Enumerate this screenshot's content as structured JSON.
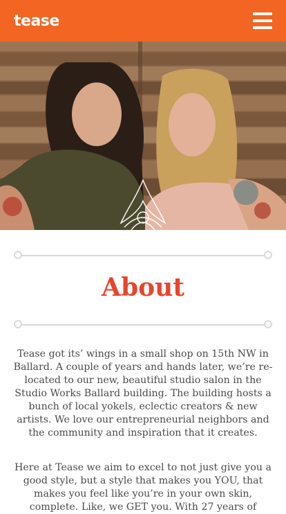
{
  "header": {
    "logo": "tease",
    "menu_icon": "hamburger-menu-icon",
    "bg_color": "#f26522"
  },
  "hero": {
    "image": "photo-two-women-wooden-fence",
    "alt": "Two smiling women standing in front of a wooden slat fence"
  },
  "about": {
    "title": "About",
    "title_color": "#e8452c",
    "paragraphs": [
      "Tease got its’ wings in a small shop on 15th NW in Ballard. A couple of years and hands later, we’re re-located to our new, beautiful studio salon in the Studio Works Ballard building. The building hosts a bunch of local yokels, eclectic creators & new artists. We love our entrepreneurial neighbors and the community and inspiration that it creates.",
      "Here at Tease we aim to excel to not just give you a good style, but a style that makes you YOU, that makes you feel like you’re in your own skin, complete. Like, we GET you. With 27 years of"
    ]
  }
}
